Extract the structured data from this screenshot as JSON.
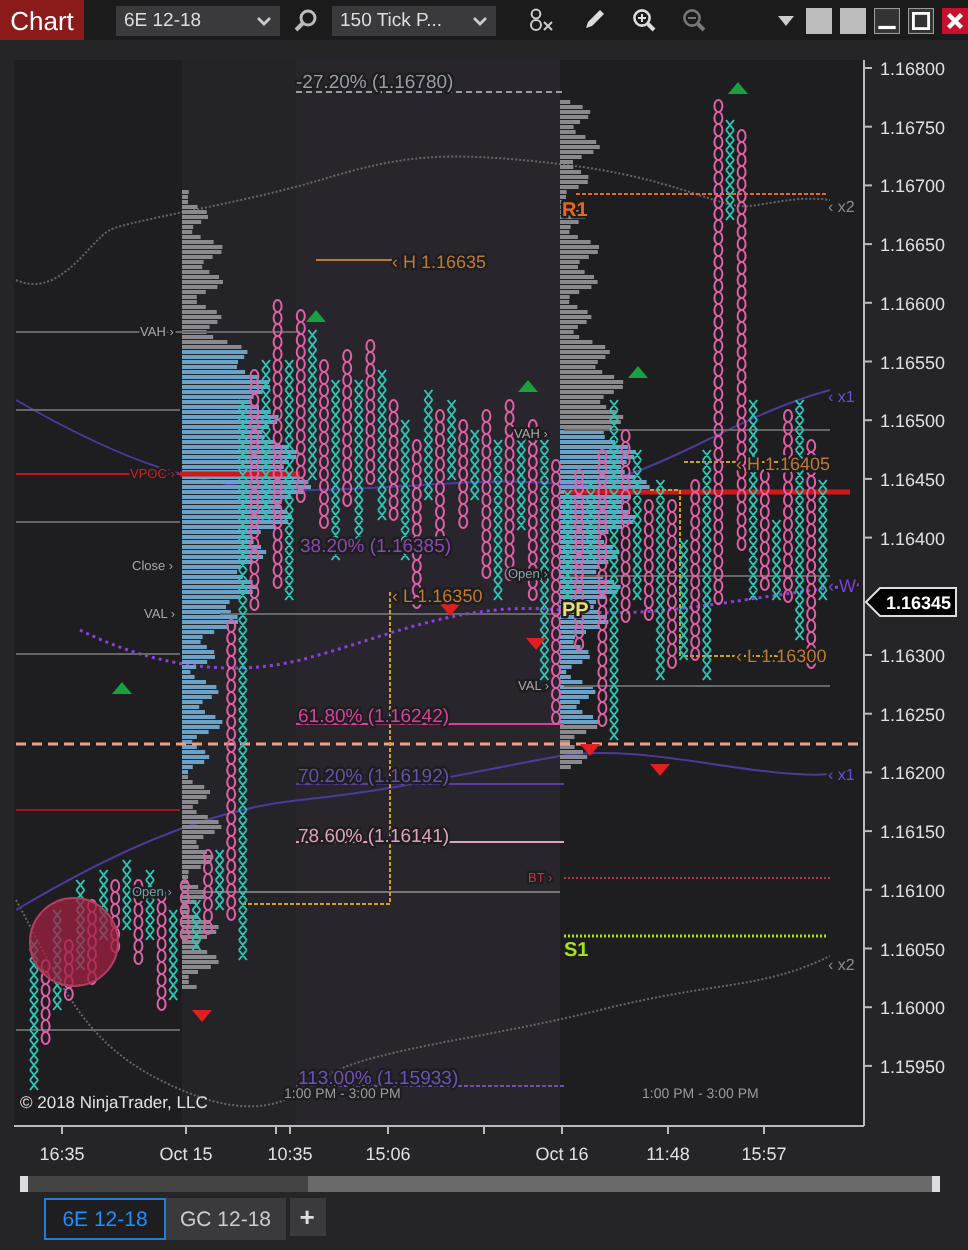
{
  "toolbar": {
    "title": "Chart",
    "instrument": "6E 12-18",
    "bar_type": "150 Tick P..."
  },
  "chart": {
    "annotations": [
      {
        "text": "-27.20% (1.16780)",
        "color": "#9a9aa8"
      },
      {
        "text": "‹ x2",
        "color": "#8a8a8a"
      },
      {
        "text": "R1",
        "color": "#e8691c"
      },
      {
        "text": "‹ H 1.16635",
        "color": "#c07a30"
      },
      {
        "text": "VAH ›",
        "color": "#a8a8a8"
      },
      {
        "text": "‹ x1",
        "color": "#6a50d0"
      },
      {
        "text": "VAH ›",
        "color": "#a8a8a8"
      },
      {
        "text": "‹ H 1.16405",
        "color": "#c07a30"
      },
      {
        "text": "VPOC ›",
        "color": "#d02020"
      },
      {
        "text": "38.20% (1.16385)",
        "color": "#8a48b0"
      },
      {
        "text": "Close ›",
        "color": "#a8a8a8"
      },
      {
        "text": "Open ›",
        "color": "#7fa8b0"
      },
      {
        "text": "‹ W",
        "color": "#7a40d8"
      },
      {
        "text": "‹ L 1.16350",
        "color": "#c07a30"
      },
      {
        "text": "PP",
        "color": "#e8e070"
      },
      {
        "text": "VAL ›",
        "color": "#a8a8a8"
      },
      {
        "text": "‹ L 1.16300",
        "color": "#c07a30"
      },
      {
        "text": "VAL ›",
        "color": "#a8a8a8"
      },
      {
        "text": "61.80% (1.16242)",
        "color": "#d8409a"
      },
      {
        "text": "‹ x1",
        "color": "#6a50d0"
      },
      {
        "text": "70.20% (1.16192)",
        "color": "#6a50a8"
      },
      {
        "text": "78.60% (1.16141)",
        "color": "#e0a0c0"
      },
      {
        "text": "BT ›",
        "color": "#d03040"
      },
      {
        "text": "Open ›",
        "color": "#6aa8a8"
      },
      {
        "text": "S1",
        "color": "#a8e020"
      },
      {
        "text": "‹ x2",
        "color": "#8a8a8a"
      },
      {
        "text": "113.00% (1.15933)",
        "color": "#7050b8"
      },
      {
        "text": "1:00 PM - 3:00 PM",
        "color": "#9a9a9a"
      },
      {
        "text": "1:00 PM - 3:00 PM",
        "color": "#9a9a9a"
      }
    ],
    "copyright": "© 2018 NinjaTrader, LLC",
    "price_axis": [
      "1.16800",
      "1.16750",
      "1.16700",
      "1.16650",
      "1.16600",
      "1.16550",
      "1.16500",
      "1.16450",
      "1.16400",
      "1.16300",
      "1.16250",
      "1.16200",
      "1.16150",
      "1.16100",
      "1.16050",
      "1.16000",
      "1.15950"
    ],
    "current_price": "1.16345",
    "time_axis": [
      "16:35",
      "Oct 15",
      "10:35",
      "15:06",
      "Oct 16",
      "11:48",
      "15:57"
    ]
  },
  "tabs": [
    {
      "label": "6E 12-18",
      "selected": true
    },
    {
      "label": "GC 12-18",
      "selected": false
    }
  ],
  "add_tab": "+"
}
